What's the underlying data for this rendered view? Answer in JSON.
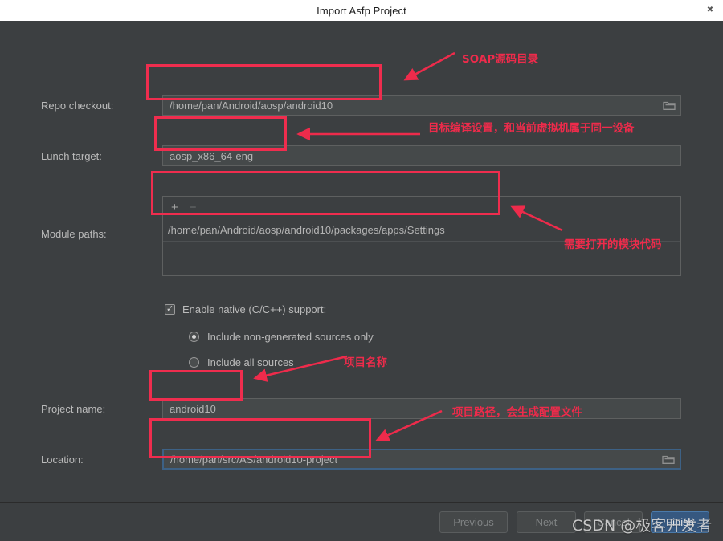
{
  "window": {
    "title": "Import Asfp Project",
    "close_icon": "close-icon"
  },
  "form": {
    "repo_checkout": {
      "label": "Repo checkout:",
      "value": "/home/pan/Android/aosp/android10",
      "browse_icon": "folder-icon"
    },
    "lunch_target": {
      "label": "Lunch target:",
      "value": "aosp_x86_64-eng"
    },
    "module_paths": {
      "label": "Module paths:",
      "add_label": "+",
      "remove_label": "−",
      "items": [
        "/home/pan/Android/aosp/android10/packages/apps/Settings"
      ]
    },
    "native_support": {
      "label": "Enable native (C/C++) support:",
      "checked_mark": "✓",
      "options": [
        {
          "label": "Include non-generated sources only",
          "selected": true
        },
        {
          "label": "Include all sources",
          "selected": false
        }
      ]
    },
    "project_name": {
      "label": "Project name:",
      "value": "android10"
    },
    "location": {
      "label": "Location:",
      "value": "/home/pan/src/AS/android10-project",
      "browse_icon": "folder-icon"
    }
  },
  "footer": {
    "previous": "Previous",
    "next": "Next",
    "cancel": "Cancel",
    "finish": "Finish"
  },
  "annotations": [
    {
      "name": "repo-checkout-note",
      "text": "SOAP源码目录"
    },
    {
      "name": "lunch-target-note",
      "text": "目标编译设置，和当前虚拟机属于同一设备"
    },
    {
      "name": "module-paths-note",
      "text": "需要打开的模块代码"
    },
    {
      "name": "project-name-note",
      "text": "项目名称"
    },
    {
      "name": "location-note",
      "text": "项目路径，会生成配置文件"
    }
  ],
  "watermark": {
    "text": "CSDN @极客开发者"
  },
  "colors": {
    "background": "#3c3f41",
    "titlebar": "#ffffff",
    "annotation_red": "#ee2b4b",
    "focus_blue": "#3d6185",
    "primary_button": "#365880"
  }
}
